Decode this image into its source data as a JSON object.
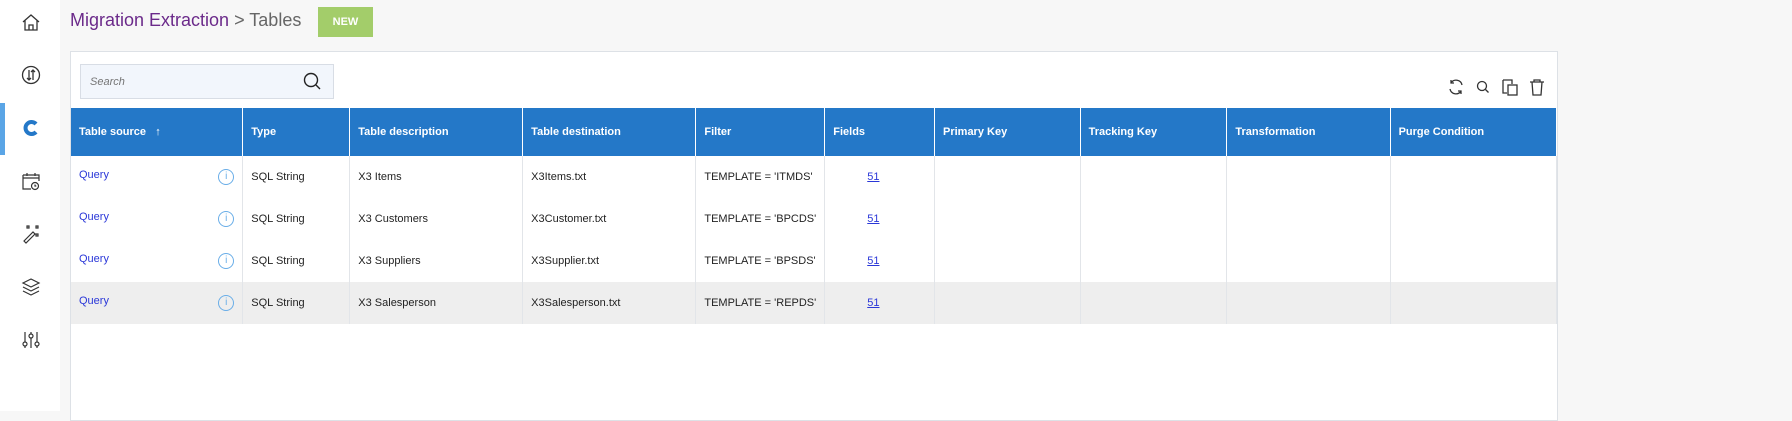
{
  "header": {
    "breadcrumb_root": "Migration Extraction",
    "separator": ">",
    "breadcrumb_current": "Tables",
    "new_label": "NEW"
  },
  "sidebar": {
    "items": [
      "home-icon",
      "sync-icon",
      "magnet-icon",
      "calendar-clock-icon",
      "magic-wand-icon",
      "layers-icon",
      "sliders-icon"
    ],
    "active": 2
  },
  "search": {
    "placeholder": "Search",
    "value": ""
  },
  "toolbar": [
    "refresh-icon",
    "search-icon",
    "copy-icon",
    "trash-icon"
  ],
  "colors": {
    "accent": "#2478c8",
    "new_button": "#a3cd6a",
    "title": "#6b2a8a"
  },
  "table": {
    "columns": [
      "Table source",
      "Type",
      "Table description",
      "Table destination",
      "Filter",
      "Fields",
      "Primary Key",
      "Tracking Key",
      "Transformation",
      "Purge Condition"
    ],
    "sort": {
      "column": "Table source",
      "direction": "ascending"
    },
    "rows": [
      {
        "source": "Query",
        "type": "SQL String",
        "description": "X3 Items",
        "destination": "X3Items.txt",
        "filter": "TEMPLATE = 'ITMDS'",
        "fields": "51"
      },
      {
        "source": "Query",
        "type": "SQL String",
        "description": "X3 Customers",
        "destination": "X3Customer.txt",
        "filter": "TEMPLATE = 'BPCDS'",
        "fields": "51"
      },
      {
        "source": "Query",
        "type": "SQL String",
        "description": "X3 Suppliers",
        "destination": "X3Supplier.txt",
        "filter": "TEMPLATE = 'BPSDS'",
        "fields": "51"
      },
      {
        "source": "Query",
        "type": "SQL String",
        "description": "X3 Salesperson",
        "destination": "X3Salesperson.txt",
        "filter": "TEMPLATE = 'REPDS'",
        "fields": "51"
      }
    ]
  }
}
